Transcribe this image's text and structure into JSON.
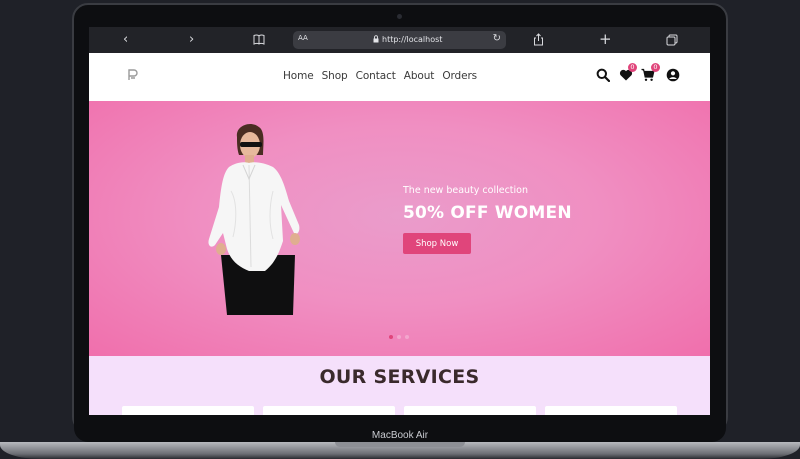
{
  "browser": {
    "url": "http://localhost",
    "reader_label": "AA"
  },
  "nav": {
    "links": [
      "Home",
      "Shop",
      "Contact",
      "About",
      "Orders"
    ],
    "wishlist_count": "0",
    "cart_count": "0"
  },
  "hero": {
    "subtitle": "The new beauty collection",
    "title": "50% OFF WOMEN",
    "cta": "Shop Now",
    "slide_count": 3,
    "active_slide": 1
  },
  "services": {
    "title": "OUR SERVICES"
  },
  "device": {
    "label": "MacBook Air"
  },
  "colors": {
    "accent": "#e0457b",
    "hero_bg": "#f08fc2",
    "services_bg": "#f5e0fb"
  }
}
